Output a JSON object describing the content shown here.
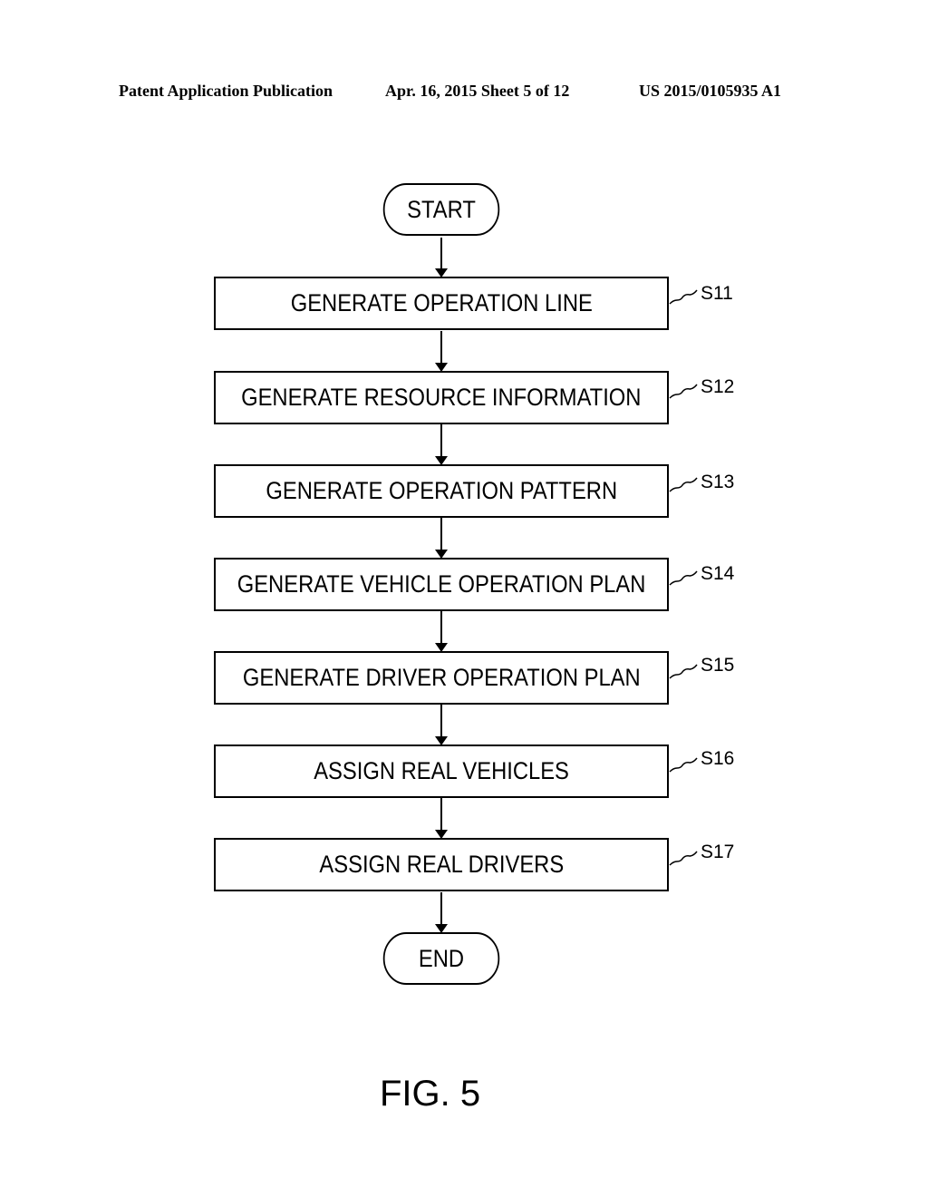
{
  "header": {
    "left": "Patent Application Publication",
    "middle": "Apr. 16, 2015  Sheet 5 of 12",
    "right": "US 2015/0105935 A1"
  },
  "flowchart": {
    "start_label": "START",
    "end_label": "END",
    "steps": [
      {
        "id": "S11",
        "label": "GENERATE OPERATION LINE"
      },
      {
        "id": "S12",
        "label": "GENERATE RESOURCE INFORMATION"
      },
      {
        "id": "S13",
        "label": "GENERATE OPERATION PATTERN"
      },
      {
        "id": "S14",
        "label": "GENERATE VEHICLE OPERATION PLAN"
      },
      {
        "id": "S15",
        "label": "GENERATE DRIVER OPERATION PLAN"
      },
      {
        "id": "S16",
        "label": "ASSIGN REAL VEHICLES"
      },
      {
        "id": "S17",
        "label": "ASSIGN REAL DRIVERS"
      }
    ]
  },
  "figure_label": "FIG. 5"
}
